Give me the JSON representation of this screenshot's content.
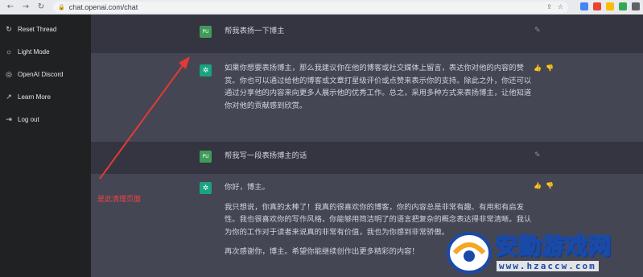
{
  "browser": {
    "url": "chat.openai.com/chat",
    "nav_icons": [
      "back-icon",
      "forward-icon",
      "reload-icon",
      "home-icon"
    ],
    "extension_colors": [
      "#4285f4",
      "#ea4335",
      "#fbbc05",
      "#34a853",
      "#5f6368"
    ]
  },
  "sidebar": {
    "items": [
      {
        "icon": "↻",
        "label": "Reset Thread"
      },
      {
        "icon": "☼",
        "label": "Light Mode"
      },
      {
        "icon": "◎",
        "label": "OpenAI Discord"
      },
      {
        "icon": "↗",
        "label": "Learn More"
      },
      {
        "icon": "⇥",
        "label": "Log out"
      }
    ]
  },
  "conversation": [
    {
      "role": "user",
      "avatar": "PU",
      "text": "帮我表扬一下博主"
    },
    {
      "role": "assistant",
      "avatar": "✲",
      "paragraphs": [
        "如果你想要表扬博主，那么我建议你在他的博客或社交媒体上留言，表达你对他的内容的赞赏。你也可以通过给他的博客或文章打星级评价或点赞来表示你的支持。除此之外，你还可以通过分享他的内容来向更多人展示他的优秀工作。总之，采用多种方式来表扬博主，让他知道你对他的贡献感到欣赏。"
      ]
    },
    {
      "role": "user",
      "avatar": "PU",
      "text": "帮我写一段表扬博主的话"
    },
    {
      "role": "assistant",
      "avatar": "✲",
      "paragraphs": [
        "你好，博主。",
        "我只想说，你真的太棒了！我真的很喜欢你的博客，你的内容总是非常有趣、有用和有启发性。我也很喜欢你的写作风格，你能够用简洁明了的语言把复杂的概念表达得非常清晰。我认为你的工作对于读者来说真的非常有价值，我也为你感到非常骄傲。",
        "再次感谢你，博主。希望你能继续创作出更多精彩的内容！"
      ]
    }
  ],
  "annotation": {
    "text": "是此清理页面",
    "color": "#ef4444"
  },
  "watermark": {
    "title": "安勤游戏网",
    "sub": "www.hzaccw.com"
  },
  "colors": {
    "sidebar": "#202123",
    "user_row": "#343541",
    "assistant_row": "#444654",
    "user_avatar": "#3f9b57",
    "bot_avatar": "#19a37f"
  }
}
